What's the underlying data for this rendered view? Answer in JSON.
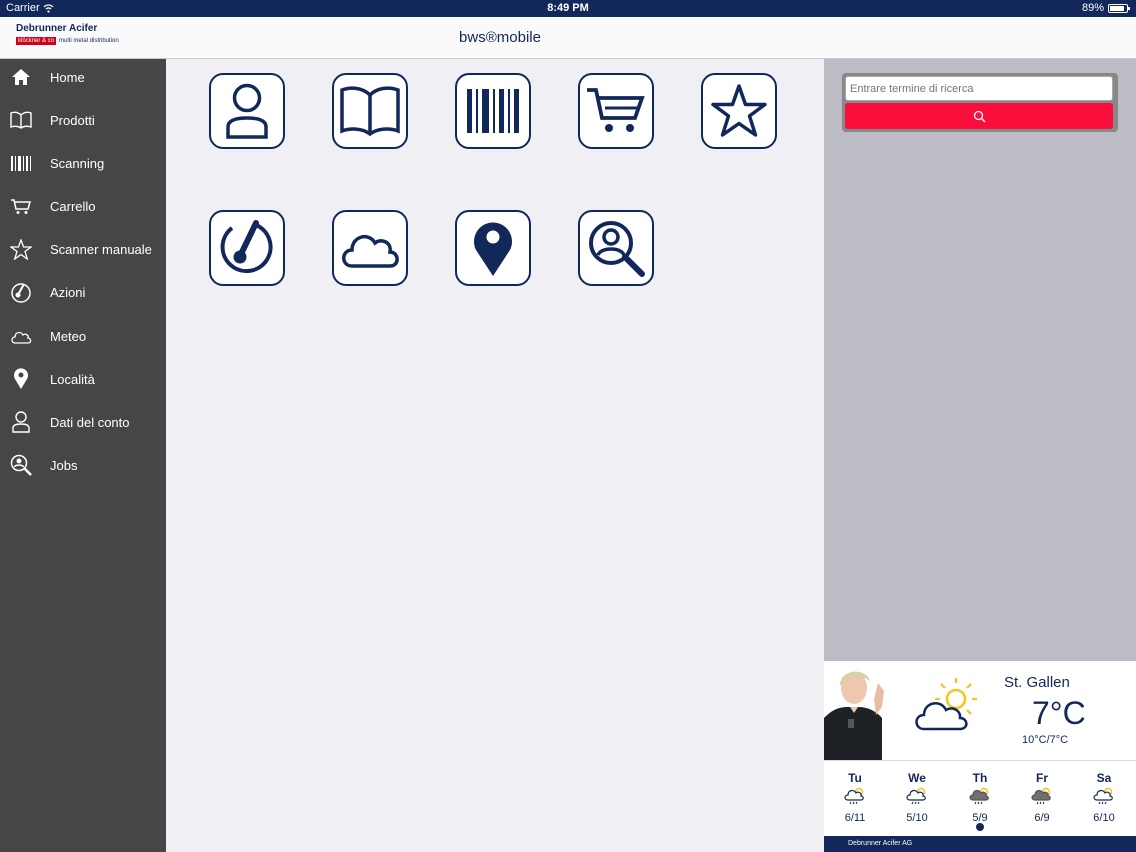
{
  "status_bar": {
    "carrier": "Carrier",
    "time": "8:49 PM",
    "battery": "89%",
    "battery_level": 0.89
  },
  "header": {
    "brand_name": "Debrunner Acifer",
    "brand_logo": "klöckner & co",
    "brand_tagline": "multi metal distribution",
    "title": "bws®mobile"
  },
  "sidebar": {
    "items": [
      {
        "label": "Home",
        "icon": "home-icon"
      },
      {
        "label": "Prodotti",
        "icon": "book-icon"
      },
      {
        "label": "Scanning",
        "icon": "barcode-icon"
      },
      {
        "label": "Carrello",
        "icon": "cart-icon"
      },
      {
        "label": "Scanner manuale",
        "icon": "star-icon"
      },
      {
        "label": "Azioni",
        "icon": "gauge-icon"
      },
      {
        "label": "Meteo",
        "icon": "cloud-icon"
      },
      {
        "label": "Località",
        "icon": "location-pin-icon"
      },
      {
        "label": "Dati del conto",
        "icon": "user-icon"
      },
      {
        "label": "Jobs",
        "icon": "magnifier-user-icon"
      }
    ]
  },
  "tiles": [
    "user-icon",
    "book-icon",
    "barcode-icon",
    "cart-icon",
    "star-icon",
    "gauge-icon",
    "cloud-icon",
    "location-pin-icon",
    "magnifier-user-icon"
  ],
  "search": {
    "placeholder": "Entrare termine di ricerca",
    "button_icon": "search-icon"
  },
  "weather": {
    "city": "St. Gallen",
    "temperature": "7°C",
    "range": "10°C/7°C",
    "forecast": [
      {
        "day": "Tu",
        "range": "6/11"
      },
      {
        "day": "We",
        "range": "5/10"
      },
      {
        "day": "Th",
        "range": "5/9"
      },
      {
        "day": "Fr",
        "range": "6/9"
      },
      {
        "day": "Sa",
        "range": "6/10"
      }
    ],
    "footer": "Debrunner Acifer AG"
  },
  "colors": {
    "navy": "#12275a",
    "sidebar": "#464646",
    "search_button": "#fb0d3c"
  }
}
